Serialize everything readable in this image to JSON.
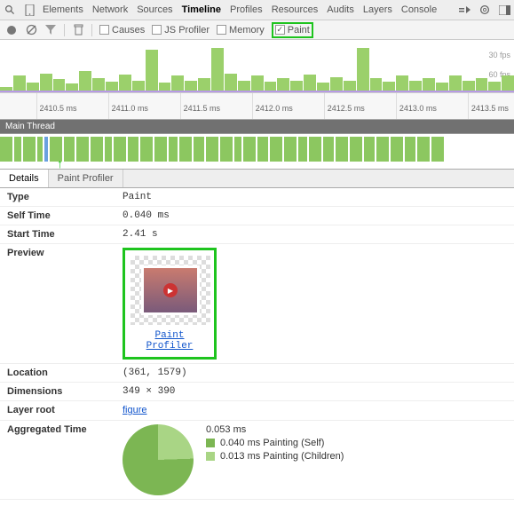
{
  "topTabs": [
    "Elements",
    "Network",
    "Sources",
    "Timeline",
    "Profiles",
    "Resources",
    "Audits",
    "Layers",
    "Console"
  ],
  "topActive": "Timeline",
  "subbar": {
    "causes": "Causes",
    "jsProfiler": "JS Profiler",
    "memory": "Memory",
    "paint": "Paint"
  },
  "fps": {
    "l30": "30 fps",
    "l60": "60 fps"
  },
  "ruler": [
    "2410.5 ms",
    "2411.0 ms",
    "2411.5 ms",
    "2412.0 ms",
    "2412.5 ms",
    "2413.0 ms",
    "2413.5 ms"
  ],
  "mainThreadLabel": "Main Thread",
  "detailTabs": {
    "details": "Details",
    "paintProfiler": "Paint Profiler"
  },
  "rows": {
    "typeK": "Type",
    "typeV": "Paint",
    "selfK": "Self Time",
    "selfV": "0.040 ms",
    "startK": "Start Time",
    "startV": "2.41 s",
    "previewK": "Preview",
    "previewLink": "Paint Profiler",
    "locK": "Location",
    "locV": "(361, 1579)",
    "dimK": "Dimensions",
    "dimV": "349 × 390",
    "layerK": "Layer root",
    "layerV": "figure",
    "aggK": "Aggregated Time",
    "aggTotal": "0.053 ms",
    "aggSelf": "0.040 ms Painting (Self)",
    "aggChildren": "0.013 ms Painting (Children)"
  },
  "colors": {
    "paintSelf": "#7cb653",
    "paintChildren": "#a9d585"
  }
}
